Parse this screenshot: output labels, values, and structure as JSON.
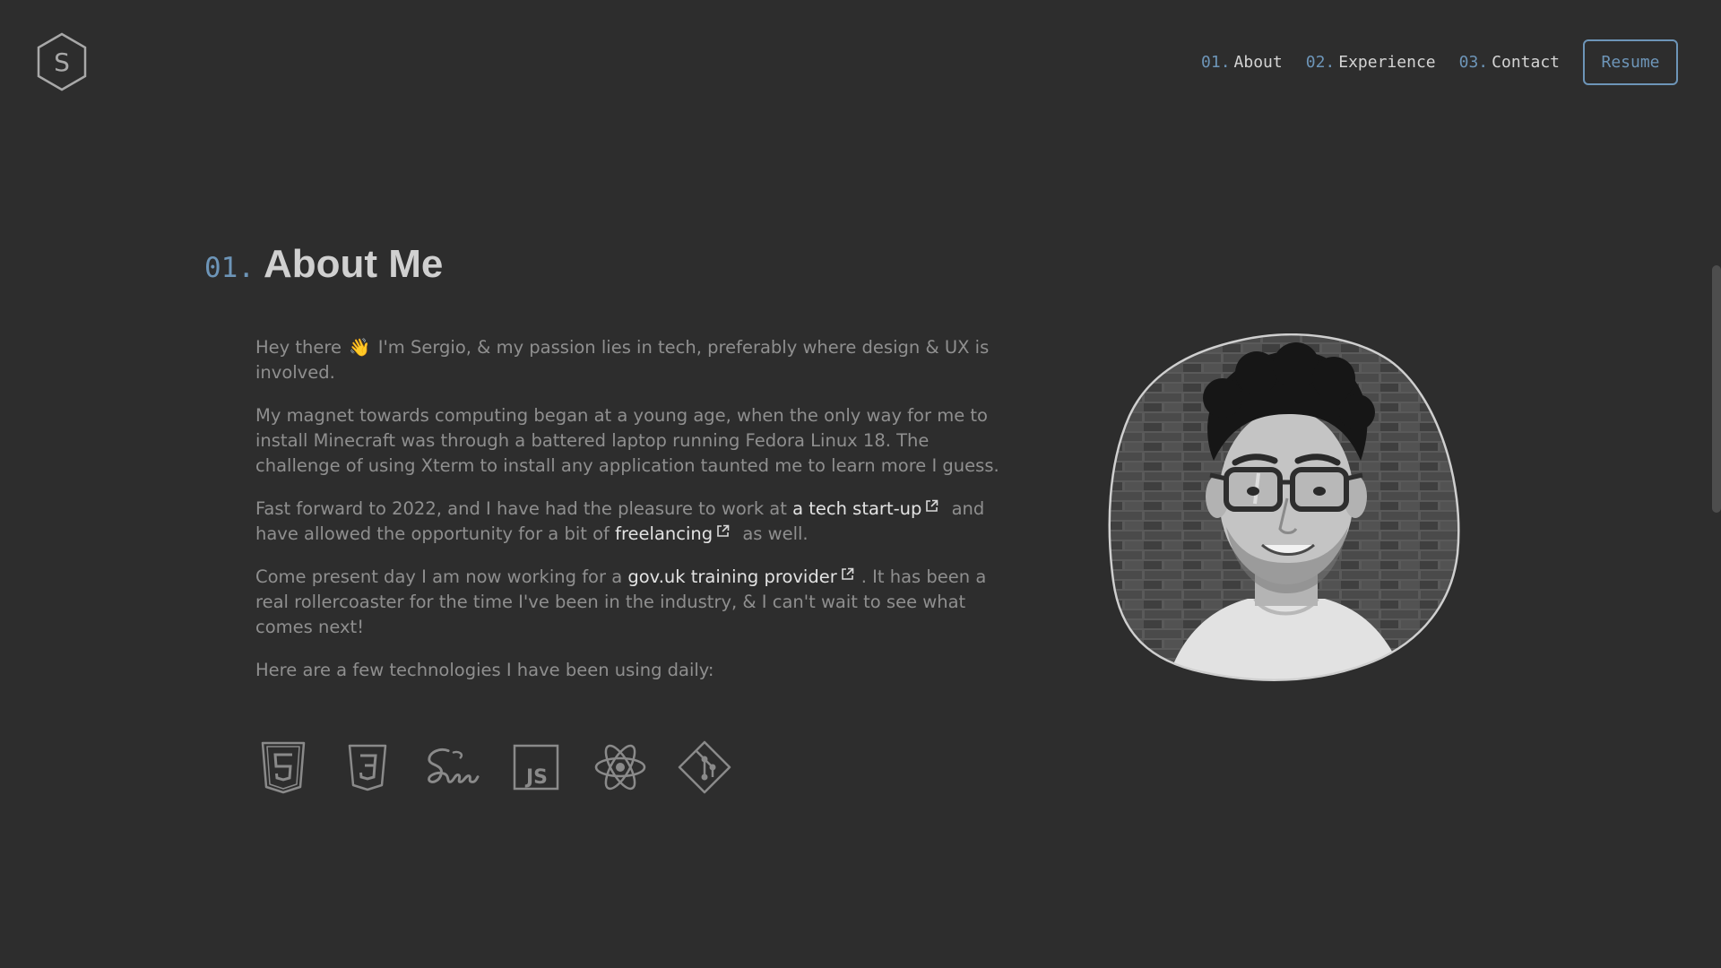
{
  "brand": {
    "logo_letter": "S",
    "logo_icon": "hexagon-logo"
  },
  "nav": {
    "items": [
      {
        "num": "01.",
        "label": "About"
      },
      {
        "num": "02.",
        "label": "Experience"
      },
      {
        "num": "03.",
        "label": "Contact"
      }
    ],
    "resume_label": "Resume"
  },
  "section": {
    "num": "01.",
    "title": "About Me"
  },
  "about": {
    "p1_a": "Hey there",
    "p1_emoji": "👋",
    "p1_b": "I'm Sergio, & my passion lies in tech, preferably where design & UX is involved.",
    "p2": "My magnet towards computing began at a young age, when the only way for me to install Minecraft was through a battered laptop running Fedora Linux 18. The challenge of using Xterm to install any application taunted me to learn more I guess.",
    "p3_a": "Fast forward to 2022, and I have had the pleasure to work at",
    "p3_link1": "a tech start-up",
    "p3_b": "and have allowed the opportunity for a bit of",
    "p3_link2": "freelancing",
    "p3_c": "as well.",
    "p4_a": "Come present day I am now working for a",
    "p4_link": "gov.uk training provider",
    "p4_b": ". It has been a real rollercoaster for the time I've been in the industry, & I can't wait to see what comes next!",
    "p5": "Here are a few technologies I have been using daily:"
  },
  "technologies": [
    "html5-icon",
    "css3-icon",
    "sass-icon",
    "javascript-icon",
    "react-icon",
    "git-icon"
  ],
  "colors": {
    "background": "#2d2d2d",
    "accent": "#6d95b8",
    "heading": "#d0d0d0",
    "body_text": "#8f8f8f",
    "link": "#e3e3e3"
  }
}
